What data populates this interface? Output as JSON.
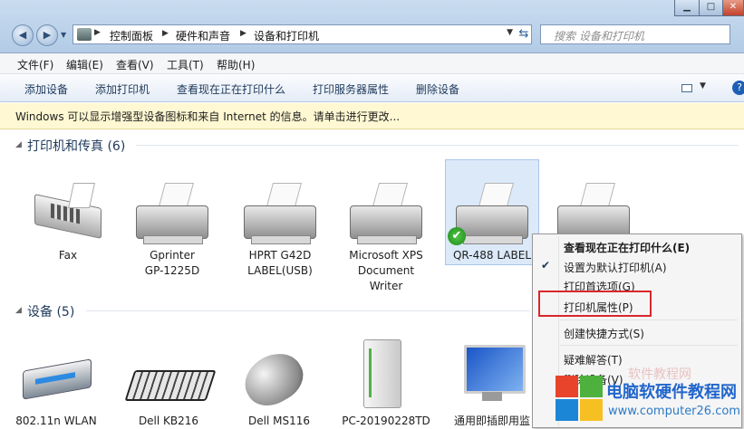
{
  "window": {
    "breadcrumb": [
      "控制面板",
      "硬件和声音",
      "设备和打印机"
    ],
    "search_placeholder": "搜索 设备和打印机"
  },
  "menubar": {
    "items": [
      "文件(F)",
      "编辑(E)",
      "查看(V)",
      "工具(T)",
      "帮助(H)"
    ]
  },
  "toolbar": {
    "items": [
      "添加设备",
      "添加打印机",
      "查看现在正在打印什么",
      "打印服务器属性",
      "删除设备"
    ]
  },
  "infobar": {
    "text": "Windows 可以显示增强型设备图标和来自 Internet 的信息。请单击进行更改..."
  },
  "printers_group": {
    "header": "打印机和传真 (6)",
    "items": [
      {
        "label": "Fax"
      },
      {
        "label": "Gprinter\nGP-1225D"
      },
      {
        "label": "HPRT G42D\nLABEL(USB)"
      },
      {
        "label": "Microsoft XPS\nDocument\nWriter"
      },
      {
        "label": "QR-488 LABEL",
        "selected": true,
        "default": true
      },
      {
        "label": ""
      }
    ]
  },
  "devices_group": {
    "header": "设备 (5)",
    "items": [
      {
        "label": "802.11n WLAN"
      },
      {
        "label": "Dell KB216"
      },
      {
        "label": "Dell MS116"
      },
      {
        "label": "PC-20190228TD"
      },
      {
        "label": "通用即插即用监"
      }
    ]
  },
  "context_menu": {
    "items": [
      {
        "label": "查看现在正在打印什么(E)",
        "bold": true
      },
      {
        "label": "设置为默认打印机(A)",
        "checked": true
      },
      {
        "label": "打印首选项(G)"
      },
      {
        "label": "打印机属性(P)",
        "highlighted": true
      },
      {
        "label": "创建快捷方式(S)"
      },
      {
        "label": "疑难解答(T)"
      },
      {
        "label": "删除设备(V)"
      }
    ]
  },
  "watermark": {
    "title": "电脑软硬件教程网",
    "url": "www.computer26.com",
    "faint": "软件教程网"
  },
  "colors": {
    "highlight_border": "#d9272c",
    "selection_bg": "#dbe9f9",
    "infobar_bg": "#fff8d2"
  }
}
